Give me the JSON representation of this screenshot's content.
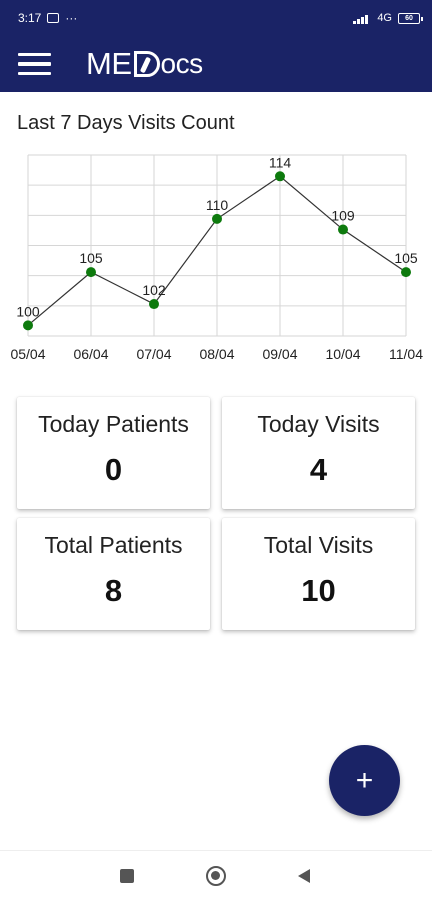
{
  "status_bar": {
    "time": "3:17",
    "dots": "···",
    "network": "4G",
    "battery": "60"
  },
  "app_bar": {
    "logo_me": "ME",
    "logo_ocs": "ocs"
  },
  "chart_data": {
    "type": "line",
    "title": "Last 7 Days Visits Count",
    "categories": [
      "05/04",
      "06/04",
      "07/04",
      "08/04",
      "09/04",
      "10/04",
      "11/04"
    ],
    "series": [
      {
        "values": [
          100,
          105,
          102,
          110,
          114,
          109,
          105
        ]
      }
    ],
    "ylim": [
      99,
      116
    ],
    "grid": true,
    "line_color": "#333333",
    "point_color": "#0d7a0d"
  },
  "stats": {
    "today_patients": {
      "label": "Today Patients",
      "value": "0"
    },
    "today_visits": {
      "label": "Today Visits",
      "value": "4"
    },
    "total_patients": {
      "label": "Total Patients",
      "value": "8"
    },
    "total_visits": {
      "label": "Total Visits",
      "value": "10"
    }
  },
  "fab": {
    "label": "+"
  },
  "colors": {
    "primary": "#1a2366"
  }
}
